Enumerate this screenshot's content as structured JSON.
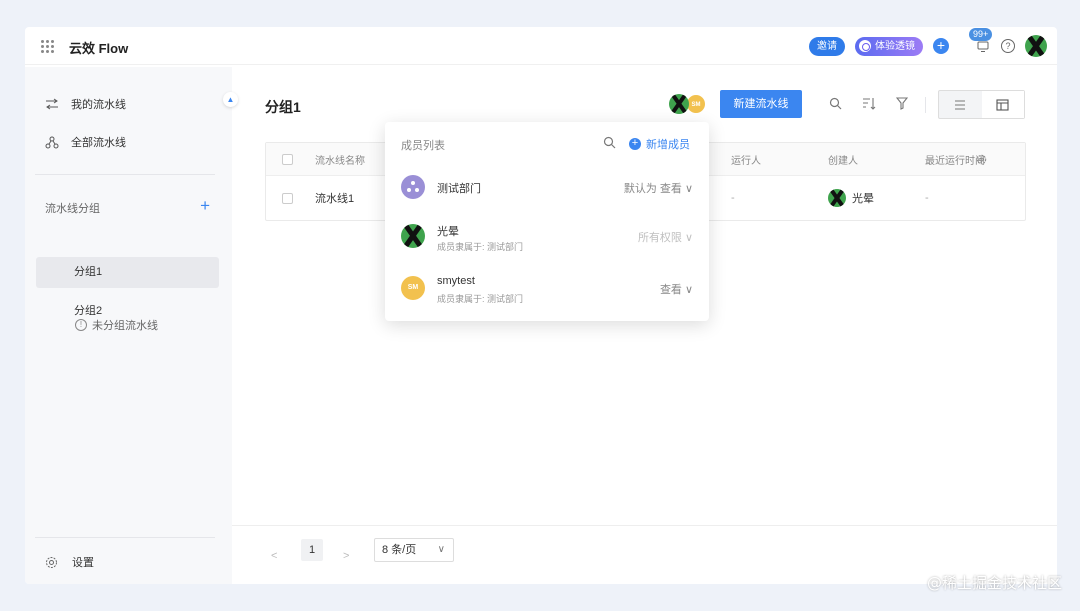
{
  "app": {
    "title": "云效 Flow"
  },
  "topbar": {
    "invite_label": "邀请",
    "trial_label": "体验透镜",
    "notification_count": "99+",
    "help_glyph": "?"
  },
  "sidebar": {
    "nav": [
      {
        "label": "我的流水线",
        "icon": "arrows-swap-icon"
      },
      {
        "label": "全部流水线",
        "icon": "nodes-icon"
      }
    ],
    "group_header": "流水线分组",
    "add_glyph": "+",
    "groups": [
      {
        "label": "分组1",
        "active": true
      },
      {
        "label": "分组2",
        "active": false
      }
    ],
    "ungrouped_label": "未分组流水线",
    "info_glyph": "!",
    "settings_label": "设置"
  },
  "main": {
    "title": "分组1",
    "new_button": "新建流水线",
    "member_sm_initials": "SM",
    "table": {
      "columns": [
        "流水线名称",
        "运行人",
        "创建人",
        "最近运行时间"
      ],
      "rows": [
        {
          "name": "流水线1",
          "runner": "-",
          "creator": "光晕",
          "last_run": "-"
        }
      ]
    },
    "pagination": {
      "prev": "<",
      "current_page": "1",
      "next": ">",
      "page_size": "8 条/页"
    }
  },
  "popover": {
    "title": "成员列表",
    "add_member": "新增成员",
    "add_glyph": "+",
    "members": [
      {
        "name": "测试部门",
        "sub": "",
        "permission": "默认为 查看",
        "disabled": false,
        "avatar": "dept"
      },
      {
        "name": "光晕",
        "sub": "成员隶属于: 测试部门",
        "permission": "所有权限",
        "disabled": true,
        "avatar": "x"
      },
      {
        "name": "smytest",
        "sub": "成员隶属于: 测试部门",
        "permission": "查看",
        "disabled": false,
        "avatar": "SM"
      }
    ]
  },
  "watermark": "@稀土掘金技术社区",
  "colors": {
    "accent": "#3b86f0",
    "background": "#eef2f9",
    "sidebar": "#f7f8fa"
  }
}
